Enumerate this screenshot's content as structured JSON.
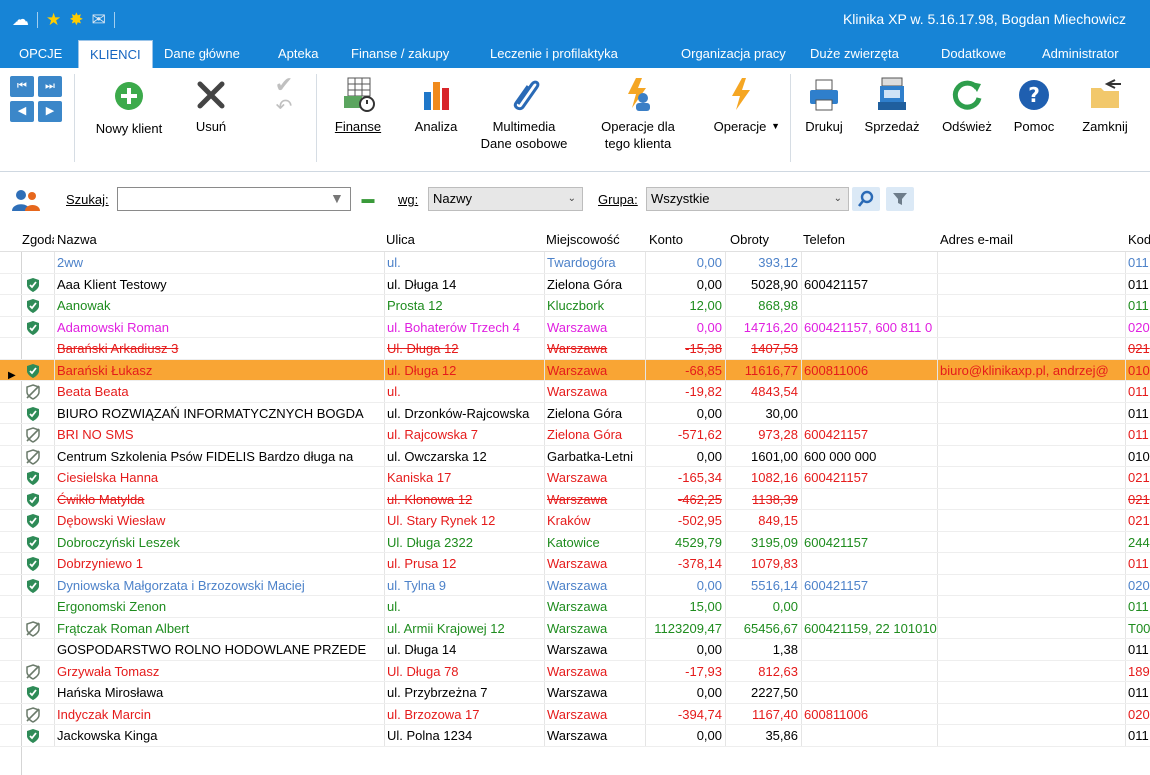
{
  "title": "Klinika XP w. 5.16.17.98, Bogdan Miechowicz",
  "quick_access": [
    "app-logo-icon",
    "star-icon",
    "sun-icon",
    "mail-icon"
  ],
  "menu": {
    "tabs": [
      {
        "label": "OPCJE"
      },
      {
        "label": "KLIENCI"
      },
      {
        "label": "Dane główne"
      },
      {
        "label": "Apteka"
      },
      {
        "label": "Finanse / zakupy"
      },
      {
        "label": "Leczenie i profilaktyka"
      },
      {
        "label": "Organizacja pracy"
      },
      {
        "label": "Duże zwierzęta"
      },
      {
        "label": "Dodatkowe"
      },
      {
        "label": "Administrator"
      }
    ],
    "active": "KLIENCI"
  },
  "ribbon": {
    "nowy_klient": "Nowy klient",
    "usun": "Usuń",
    "finanse": "Finanse",
    "analiza": "Analiza",
    "multimedia_1": "Multimedia",
    "multimedia_2": "Dane osobowe",
    "operacje_dla_1": "Operacje dla",
    "operacje_dla_2": "tego klienta",
    "operacje": "Operacje",
    "drukuj": "Drukuj",
    "sprzedaz": "Sprzedaż",
    "odswiez": "Odśwież",
    "pomoc": "Pomoc",
    "zamknij": "Zamknij"
  },
  "search": {
    "szukaj_label": "Szukaj:",
    "szukaj_value": "",
    "wg_label": "wg:",
    "wg_value": "Nazwy",
    "grupa_label": "Grupa:",
    "grupa_value": "Wszystkie"
  },
  "colors": {
    "title_bar": "#1784d6",
    "selected_row": "#f9a534",
    "green": "#1e8c1e",
    "red": "#e51b1b",
    "blue": "#4d82c9",
    "magenta": "#e020e0",
    "black": "#000000"
  },
  "grid": {
    "columns": {
      "zgoda": "Zgoda",
      "nazwa": "Nazwa",
      "ulica": "Ulica",
      "miejscowosc": "Miejscowość",
      "konto": "Konto",
      "obroty": "Obroty",
      "telefon": "Telefon",
      "email": "Adres e-mail",
      "kod": "Kod"
    },
    "rows": [
      {
        "icon": "",
        "color": "blue",
        "strike": false,
        "sel": false,
        "nazwa": "2ww",
        "ulica": "ul.",
        "miejscowosc": "Twardogóra",
        "konto": "0,00",
        "obroty": "393,12",
        "telefon": "",
        "email": "",
        "kod": "011"
      },
      {
        "icon": "shield-icon",
        "color": "black",
        "strike": false,
        "sel": false,
        "nazwa": "Aaa Klient Testowy",
        "ulica": "ul. Długa 14",
        "miejscowosc": "Zielona Góra",
        "konto": "0,00",
        "obroty": "5028,90",
        "telefon": "600421157",
        "email": "",
        "kod": "011"
      },
      {
        "icon": "shield-icon",
        "color": "green",
        "strike": false,
        "sel": false,
        "nazwa": "Aanowak",
        "ulica": "Prosta 12",
        "miejscowosc": "Kluczbork",
        "konto": "12,00",
        "obroty": "868,98",
        "telefon": "",
        "email": "",
        "kod": "011"
      },
      {
        "icon": "shield-icon",
        "color": "magenta",
        "strike": false,
        "sel": false,
        "nazwa": "Adamowski Roman",
        "ulica": "ul. Bohaterów Trzech 4",
        "miejscowosc": "Warszawa",
        "konto": "0,00",
        "obroty": "14716,20",
        "telefon": "600421157, 600 811 0",
        "email": "",
        "kod": "020"
      },
      {
        "icon": "",
        "color": "red",
        "strike": true,
        "sel": false,
        "nazwa": "Barański Arkadiusz 3",
        "ulica": "Ul. Długa 12",
        "miejscowosc": "Warszawa",
        "konto": "-15,38",
        "obroty": "1407,53",
        "telefon": "",
        "email": "",
        "kod": "021"
      },
      {
        "icon": "shield-icon",
        "color": "red",
        "strike": false,
        "sel": true,
        "nazwa": "Barański Łukasz",
        "ulica": "ul. Długa 12",
        "miejscowosc": "Warszawa",
        "konto": "-68,85",
        "obroty": "11616,77",
        "telefon": "600811006",
        "email": "biuro@klinikaxp.pl, andrzej@",
        "kod": "010"
      },
      {
        "icon": "shield-off-icon",
        "color": "red",
        "strike": false,
        "sel": false,
        "nazwa": "Beata Beata",
        "ulica": "ul.",
        "miejscowosc": "Warszawa",
        "konto": "-19,82",
        "obroty": "4843,54",
        "telefon": "",
        "email": "",
        "kod": "011"
      },
      {
        "icon": "shield-icon",
        "color": "black",
        "strike": false,
        "sel": false,
        "nazwa": "BIURO ROZWIĄZAŃ INFORMATYCZNYCH BOGDA",
        "ulica": "ul. Drzonków-Rajcowska",
        "miejscowosc": "Zielona Góra",
        "konto": "0,00",
        "obroty": "30,00",
        "telefon": "",
        "email": "",
        "kod": "011"
      },
      {
        "icon": "shield-off-icon",
        "color": "red",
        "strike": false,
        "sel": false,
        "nazwa": "BRI NO SMS",
        "ulica": "ul. Rajcowska 7",
        "miejscowosc": "Zielona Góra",
        "konto": "-571,62",
        "obroty": "973,28",
        "telefon": "600421157",
        "email": "",
        "kod": "011"
      },
      {
        "icon": "shield-off-icon",
        "color": "black",
        "strike": false,
        "sel": false,
        "nazwa": "Centrum Szkolenia Psów  FIDELIS Bardzo długa na",
        "ulica": "ul. Owczarska 12",
        "miejscowosc": "Garbatka-Letni",
        "konto": "0,00",
        "obroty": "1601,00",
        "telefon": "600 000 000",
        "email": "",
        "kod": "010"
      },
      {
        "icon": "shield-icon",
        "color": "red",
        "strike": false,
        "sel": false,
        "nazwa": "Ciesielska Hanna",
        "ulica": "Kaniska 17",
        "miejscowosc": "Warszawa",
        "konto": "-165,34",
        "obroty": "1082,16",
        "telefon": "600421157",
        "email": "",
        "kod": "021"
      },
      {
        "icon": "shield-icon",
        "color": "red",
        "strike": true,
        "sel": false,
        "nazwa": "Ćwikło Matylda",
        "ulica": "ul. Klonowa 12",
        "miejscowosc": "Warszawa",
        "konto": "-462,25",
        "obroty": "1138,39",
        "telefon": "",
        "email": "",
        "kod": "021"
      },
      {
        "icon": "shield-icon",
        "color": "red",
        "strike": false,
        "sel": false,
        "nazwa": "Dębowski Wiesław",
        "ulica": "Ul. Stary Rynek 12",
        "miejscowosc": "Kraków",
        "konto": "-502,95",
        "obroty": "849,15",
        "telefon": "",
        "email": "",
        "kod": "021"
      },
      {
        "icon": "shield-icon",
        "color": "green",
        "strike": false,
        "sel": false,
        "nazwa": "Dobroczyński Leszek",
        "ulica": "Ul. Długa 2322",
        "miejscowosc": "Katowice",
        "konto": "4529,79",
        "obroty": "3195,09",
        "telefon": "600421157",
        "email": "",
        "kod": "244"
      },
      {
        "icon": "shield-icon",
        "color": "red",
        "strike": false,
        "sel": false,
        "nazwa": "Dobrzyniewo 1",
        "ulica": "ul. Prusa 12",
        "miejscowosc": "Warszawa",
        "konto": "-378,14",
        "obroty": "1079,83",
        "telefon": "",
        "email": "",
        "kod": "011"
      },
      {
        "icon": "shield-icon",
        "color": "blue",
        "strike": false,
        "sel": false,
        "nazwa": "Dyniowska Małgorzata i Brzozowski Maciej",
        "ulica": "ul. Tylna 9",
        "miejscowosc": "Warszawa",
        "konto": "0,00",
        "obroty": "5516,14",
        "telefon": "600421157",
        "email": "",
        "kod": "020"
      },
      {
        "icon": "",
        "color": "green",
        "strike": false,
        "sel": false,
        "nazwa": "Ergonomski Zenon",
        "ulica": "ul.",
        "miejscowosc": "Warszawa",
        "konto": "15,00",
        "obroty": "0,00",
        "telefon": "",
        "email": "",
        "kod": "011"
      },
      {
        "icon": "shield-off-icon",
        "color": "green",
        "strike": false,
        "sel": false,
        "nazwa": "Frątczak Roman Albert",
        "ulica": "ul. Armii Krajowej 12",
        "miejscowosc": "Warszawa",
        "konto": "1123209,47",
        "obroty": "65456,67",
        "telefon": "600421159, 22 101010",
        "email": "",
        "kod": "T00"
      },
      {
        "icon": "",
        "color": "black",
        "strike": false,
        "sel": false,
        "nazwa": "GOSPODARSTWO ROLNO HODOWLANE PRZEDE",
        "ulica": "ul. Długa 14",
        "miejscowosc": "Warszawa",
        "konto": "0,00",
        "obroty": "1,38",
        "telefon": "",
        "email": "",
        "kod": "011"
      },
      {
        "icon": "shield-off-icon",
        "color": "red",
        "strike": false,
        "sel": false,
        "nazwa": "Grzywała Tomasz",
        "ulica": "Ul. Długa 78",
        "miejscowosc": "Warszawa",
        "konto": "-17,93",
        "obroty": "812,63",
        "telefon": "",
        "email": "",
        "kod": "189"
      },
      {
        "icon": "shield-icon",
        "color": "black",
        "strike": false,
        "sel": false,
        "nazwa": "Hańska Mirosława",
        "ulica": "ul. Przybrzeżna 7",
        "miejscowosc": "Warszawa",
        "konto": "0,00",
        "obroty": "2227,50",
        "telefon": "",
        "email": "",
        "kod": "011"
      },
      {
        "icon": "shield-off-icon",
        "color": "red",
        "strike": false,
        "sel": false,
        "nazwa": "Indyczak Marcin",
        "ulica": "ul. Brzozowa 17",
        "miejscowosc": "Warszawa",
        "konto": "-394,74",
        "obroty": "1167,40",
        "telefon": "600811006",
        "email": "",
        "kod": "020"
      },
      {
        "icon": "shield-icon",
        "color": "black",
        "strike": false,
        "sel": false,
        "nazwa": "Jackowska Kinga",
        "ulica": "Ul. Polna 1234",
        "miejscowosc": "Warszawa",
        "konto": "0,00",
        "obroty": "35,86",
        "telefon": "",
        "email": "",
        "kod": "011"
      }
    ]
  }
}
